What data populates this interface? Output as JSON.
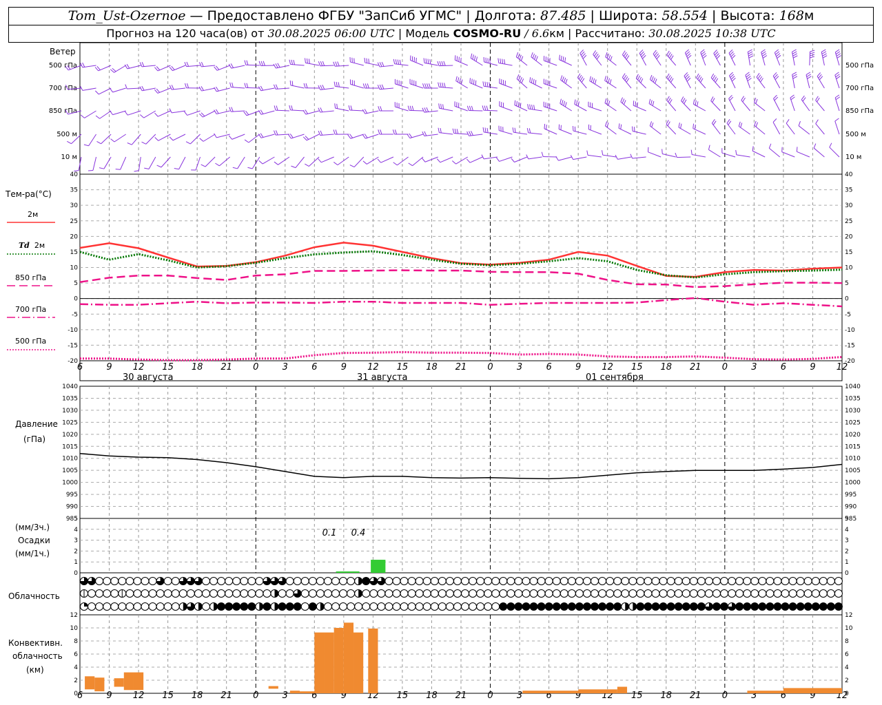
{
  "header": {
    "station": "Tom_Ust-Ozernoe",
    "provider": " — Предоставлено ФГБУ \"ЗапСиб УГМС\" | Долгота: ",
    "lon": "87.485",
    "lat_label": " | Широта: ",
    "lat": "58.554",
    "alt_label": " | Высота: ",
    "alt": "168",
    "alt_unit": "м",
    "forecast_prefix": "Прогноз на 120 часа(ов) от ",
    "forecast_from": "30.08.2025 06:00 UTC",
    "model_label": " | Модель ",
    "model": "COSMO-RU",
    "model_res": " / 6.6",
    "model_res_unit": "км",
    "calc_label": " | Рассчитано: ",
    "calc_time": "30.08.2025 10:38 UTC"
  },
  "labels": {
    "wind": "Ветер",
    "levels": [
      "500 гПа",
      "700 гПа",
      "850 гПа",
      "500 м",
      "10 м"
    ],
    "temp": "Тем-ра(°С)",
    "series_2m": "2м",
    "td": "Td",
    "td_2m": "2м",
    "t850": "850 гПа",
    "t700": "700 гПа",
    "t500": "500 гПа",
    "pressure": "Давление",
    "pressure_unit": "(гПа)",
    "precip_unit1": "(мм/3ч.)",
    "precip": "Осадки",
    "precip_unit2": "(мм/1ч.)",
    "cloud": "Облачность",
    "conv1": "Конвективн.",
    "conv2": "облачность",
    "conv3": "(км)",
    "day1": "30 августа",
    "day2": "31 августа",
    "day3": "01 сентября"
  },
  "chart_data": [
    {
      "type": "line",
      "title": "Температура",
      "ylabel": "Тем-ра(°С)",
      "ylim": [
        -20,
        40
      ],
      "yticks": [
        -20,
        -15,
        -10,
        -5,
        0,
        5,
        10,
        15,
        20,
        25,
        30,
        35,
        40
      ],
      "x_hours": [
        0,
        3,
        6,
        9,
        12,
        15,
        18,
        21,
        24,
        27,
        30,
        33,
        36,
        39,
        42,
        45,
        48,
        51,
        54,
        57,
        60,
        63,
        66,
        69,
        72,
        75,
        78
      ],
      "xtick_labels": [
        "6",
        "9",
        "12",
        "15",
        "18",
        "21",
        "0",
        "3",
        "6",
        "9",
        "12",
        "15",
        "18",
        "21",
        "0",
        "3",
        "6",
        "9",
        "12",
        "15",
        "18",
        "21",
        "0",
        "3",
        "6",
        "9",
        "12"
      ],
      "series": [
        {
          "name": "2м",
          "color": "#ff3333",
          "style": "solid",
          "values": [
            16.3,
            17.8,
            16.2,
            13.2,
            10.3,
            10.5,
            11.7,
            13.8,
            16.5,
            18.0,
            17.0,
            15.0,
            13.0,
            11.4,
            10.9,
            11.5,
            12.5,
            15.0,
            13.8,
            10.5,
            7.3,
            7.0,
            8.5,
            9.2,
            9.0,
            9.6,
            10.0
          ]
        },
        {
          "name": "Td 2м",
          "color": "#007700",
          "style": "dotted",
          "values": [
            15.0,
            12.5,
            14.3,
            12.3,
            10.0,
            10.4,
            11.5,
            13.0,
            14.2,
            14.8,
            15.2,
            14.0,
            12.5,
            11.2,
            10.7,
            11.2,
            12.0,
            13.0,
            12.0,
            9.2,
            7.5,
            6.8,
            7.8,
            8.5,
            8.8,
            9.0,
            9.3
          ]
        },
        {
          "name": "850 гПа",
          "color": "#ee1188",
          "style": "dashed",
          "values": [
            5.3,
            6.7,
            7.4,
            7.4,
            6.6,
            6.0,
            7.4,
            7.8,
            8.9,
            8.9,
            9.0,
            9.1,
            9.0,
            9.0,
            8.6,
            8.5,
            8.5,
            8.0,
            6.0,
            4.6,
            4.5,
            3.7,
            4.0,
            4.6,
            5.1,
            5.1,
            5.0
          ]
        },
        {
          "name": "700 гПа",
          "color": "#ee1188",
          "style": "dashdot",
          "values": [
            -1.8,
            -2.0,
            -2.0,
            -1.5,
            -1.0,
            -1.5,
            -1.3,
            -1.3,
            -1.4,
            -1.0,
            -1.0,
            -1.4,
            -1.4,
            -1.4,
            -2.0,
            -1.7,
            -1.4,
            -1.4,
            -1.4,
            -1.3,
            -0.5,
            0.2,
            -1.0,
            -2.0,
            -1.5,
            -2.0,
            -2.5
          ]
        },
        {
          "name": "500 гПа",
          "color": "#ee1188",
          "style": "dotted",
          "values": [
            -19.3,
            -19.3,
            -19.6,
            -19.8,
            -19.8,
            -19.6,
            -19.3,
            -19.3,
            -18.2,
            -17.5,
            -17.4,
            -17.2,
            -17.4,
            -17.4,
            -17.5,
            -18.0,
            -17.8,
            -18.0,
            -18.6,
            -18.8,
            -18.8,
            -18.6,
            -19.0,
            -19.5,
            -19.6,
            -19.4,
            -18.8
          ]
        }
      ]
    },
    {
      "type": "line",
      "title": "Давление",
      "ylabel": "Давление (гПа)",
      "ylim": [
        985,
        1040
      ],
      "yticks": [
        985,
        990,
        995,
        1000,
        1005,
        1010,
        1015,
        1020,
        1025,
        1030,
        1035,
        1040
      ],
      "x_hours": [
        0,
        3,
        6,
        9,
        12,
        15,
        18,
        21,
        24,
        27,
        30,
        33,
        36,
        39,
        42,
        45,
        48,
        51,
        54,
        57,
        60,
        63,
        66,
        69,
        72,
        75,
        78
      ],
      "series": [
        {
          "name": "Давление",
          "color": "#000000",
          "values": [
            1012.0,
            1011.0,
            1010.5,
            1010.3,
            1009.5,
            1008.2,
            1006.5,
            1004.5,
            1002.5,
            1002.0,
            1002.5,
            1002.5,
            1002.0,
            1001.8,
            1002.0,
            1001.7,
            1001.5,
            1002.0,
            1003.0,
            1004.0,
            1004.5,
            1005.0,
            1005.0,
            1005.0,
            1005.5,
            1006.2,
            1007.5
          ]
        }
      ]
    },
    {
      "type": "bar",
      "title": "Осадки",
      "ylabel": "Осадки (мм/3ч.) (мм/1ч.)",
      "ylim": [
        0,
        5
      ],
      "yticks": [
        0,
        1,
        2,
        3,
        4,
        5
      ],
      "bars": [
        {
          "from_hour": 25.5,
          "to_hour": 28.5,
          "value": 0.1
        },
        {
          "from_hour": 28.5,
          "to_hour": 31.5,
          "value": 0.4
        }
      ],
      "annotations": [
        "0.1",
        "0.4"
      ],
      "color": "#33cc33"
    },
    {
      "type": "bar",
      "title": "Конвективн. облачность",
      "ylabel": "Конвективн. облачность (км)",
      "ylim": [
        0,
        12
      ],
      "yticks": [
        0,
        2,
        4,
        6,
        8,
        10,
        12
      ],
      "color": "#f08a30",
      "bars": [
        {
          "from_hour": 0.5,
          "to_hour": 1.5,
          "bottom": 0.6,
          "top": 2.6
        },
        {
          "from_hour": 1.5,
          "to_hour": 2.5,
          "bottom": 0.3,
          "top": 2.4
        },
        {
          "from_hour": 3.5,
          "to_hour": 4.5,
          "bottom": 1.0,
          "top": 2.3
        },
        {
          "from_hour": 4.5,
          "to_hour": 5.5,
          "bottom": 0.5,
          "top": 3.2
        },
        {
          "from_hour": 5.5,
          "to_hour": 6.5,
          "bottom": 0.5,
          "top": 3.2
        },
        {
          "from_hour": 19.3,
          "to_hour": 20.3,
          "bottom": 0.7,
          "top": 1.1
        },
        {
          "from_hour": 21.5,
          "to_hour": 22.5,
          "bottom": 0.0,
          "top": 0.4
        },
        {
          "from_hour": 22.5,
          "to_hour": 24.0,
          "bottom": 0.0,
          "top": 0.3
        },
        {
          "from_hour": 24.0,
          "to_hour": 25.0,
          "bottom": 0.0,
          "top": 9.3
        },
        {
          "from_hour": 25.0,
          "to_hour": 26.0,
          "bottom": 0.0,
          "top": 9.3
        },
        {
          "from_hour": 26.0,
          "to_hour": 27.0,
          "bottom": 0.0,
          "top": 10.0
        },
        {
          "from_hour": 27.0,
          "to_hour": 28.0,
          "bottom": 0.0,
          "top": 10.8
        },
        {
          "from_hour": 28.0,
          "to_hour": 29.0,
          "bottom": 0.0,
          "top": 9.3
        },
        {
          "from_hour": 29.0,
          "to_hour": 29.5,
          "bottom": 0.0,
          "top": 0.0
        },
        {
          "from_hour": 29.5,
          "to_hour": 30.5,
          "bottom": 0.0,
          "top": 9.9
        },
        {
          "from_hour": 45.3,
          "to_hour": 51.0,
          "bottom": 0.0,
          "top": 0.4
        },
        {
          "from_hour": 51.0,
          "to_hour": 55.0,
          "bottom": 0.0,
          "top": 0.6
        },
        {
          "from_hour": 55.0,
          "to_hour": 56.0,
          "bottom": 0.0,
          "top": 1.0
        },
        {
          "from_hour": 68.3,
          "to_hour": 72.0,
          "bottom": 0.0,
          "top": 0.4
        },
        {
          "from_hour": 72.0,
          "to_hour": 78.0,
          "bottom": 0.0,
          "top": 0.8
        }
      ]
    },
    {
      "type": "table",
      "title": "Облачность",
      "symbol_legend": {
        "E": "пусто",
        "Q": "четверть",
        "H": "половина",
        "T": "три четверти",
        "F": "сплошная",
        "V": "вертикальная черта"
      },
      "rows": [
        "TTEEEEEEEETEETTTEEEEEEEETTTEEEEEEEEEHFTTEEEEEEEEEEEEEEEEEEEEEEEEEEEEEEEEEEEEEEEEEEEEEEEEEEEEEEEEEEEE",
        "VEEEEVEEEEEEEEEEEEEEEEEEEHEETEEEEEEEHEEEEEEEEEEEEEEEEEEEEEEEEEEEEEEEEEEEEEEEEEEEEEEEEEEEEEEEEEEEEEEEE",
        "QEEEEEEEEEEEEHTHEHFFFFFHFHFFFEFHEEEEEEEEEEEEEEEEEEEEEEEFFFFFFFFFFFFFFFFHHFFFFFFFFFTFFTFFFFFFFFFFFFFFFF"
      ]
    },
    {
      "type": "scatter",
      "title": "Ветер",
      "ylabel": "Ветер",
      "levels": [
        "500 гПа",
        "700 гПа",
        "850 гПа",
        "500 м",
        "10 м"
      ],
      "direction_deg": [
        [
          250,
          255,
          260,
          270,
          275,
          280,
          290,
          300,
          320,
          330,
          340,
          350,
          355
        ],
        [
          255,
          260,
          265,
          270,
          275,
          280,
          290,
          300,
          310,
          320,
          330,
          340,
          345
        ],
        [
          245,
          250,
          255,
          265,
          270,
          275,
          280,
          290,
          300,
          310,
          320,
          330,
          335
        ],
        [
          225,
          235,
          245,
          255,
          260,
          265,
          275,
          285,
          295,
          305,
          315,
          320,
          330
        ],
        [
          200,
          210,
          220,
          230,
          235,
          240,
          250,
          260,
          270,
          280,
          290,
          300,
          310
        ]
      ],
      "speed_ms": [
        [
          8,
          10,
          12,
          14,
          16,
          20,
          24,
          28,
          28,
          26,
          24,
          22,
          20
        ],
        [
          6,
          8,
          10,
          12,
          14,
          18,
          20,
          22,
          22,
          20,
          18,
          16,
          14
        ],
        [
          5,
          6,
          8,
          10,
          12,
          14,
          16,
          18,
          16,
          14,
          12,
          10,
          10
        ],
        [
          4,
          5,
          6,
          8,
          10,
          12,
          14,
          12,
          10,
          8,
          8,
          6,
          6
        ],
        [
          2,
          3,
          4,
          4,
          5,
          6,
          6,
          5,
          5,
          4,
          4,
          3,
          3
        ]
      ],
      "color": "#8833dd"
    }
  ]
}
